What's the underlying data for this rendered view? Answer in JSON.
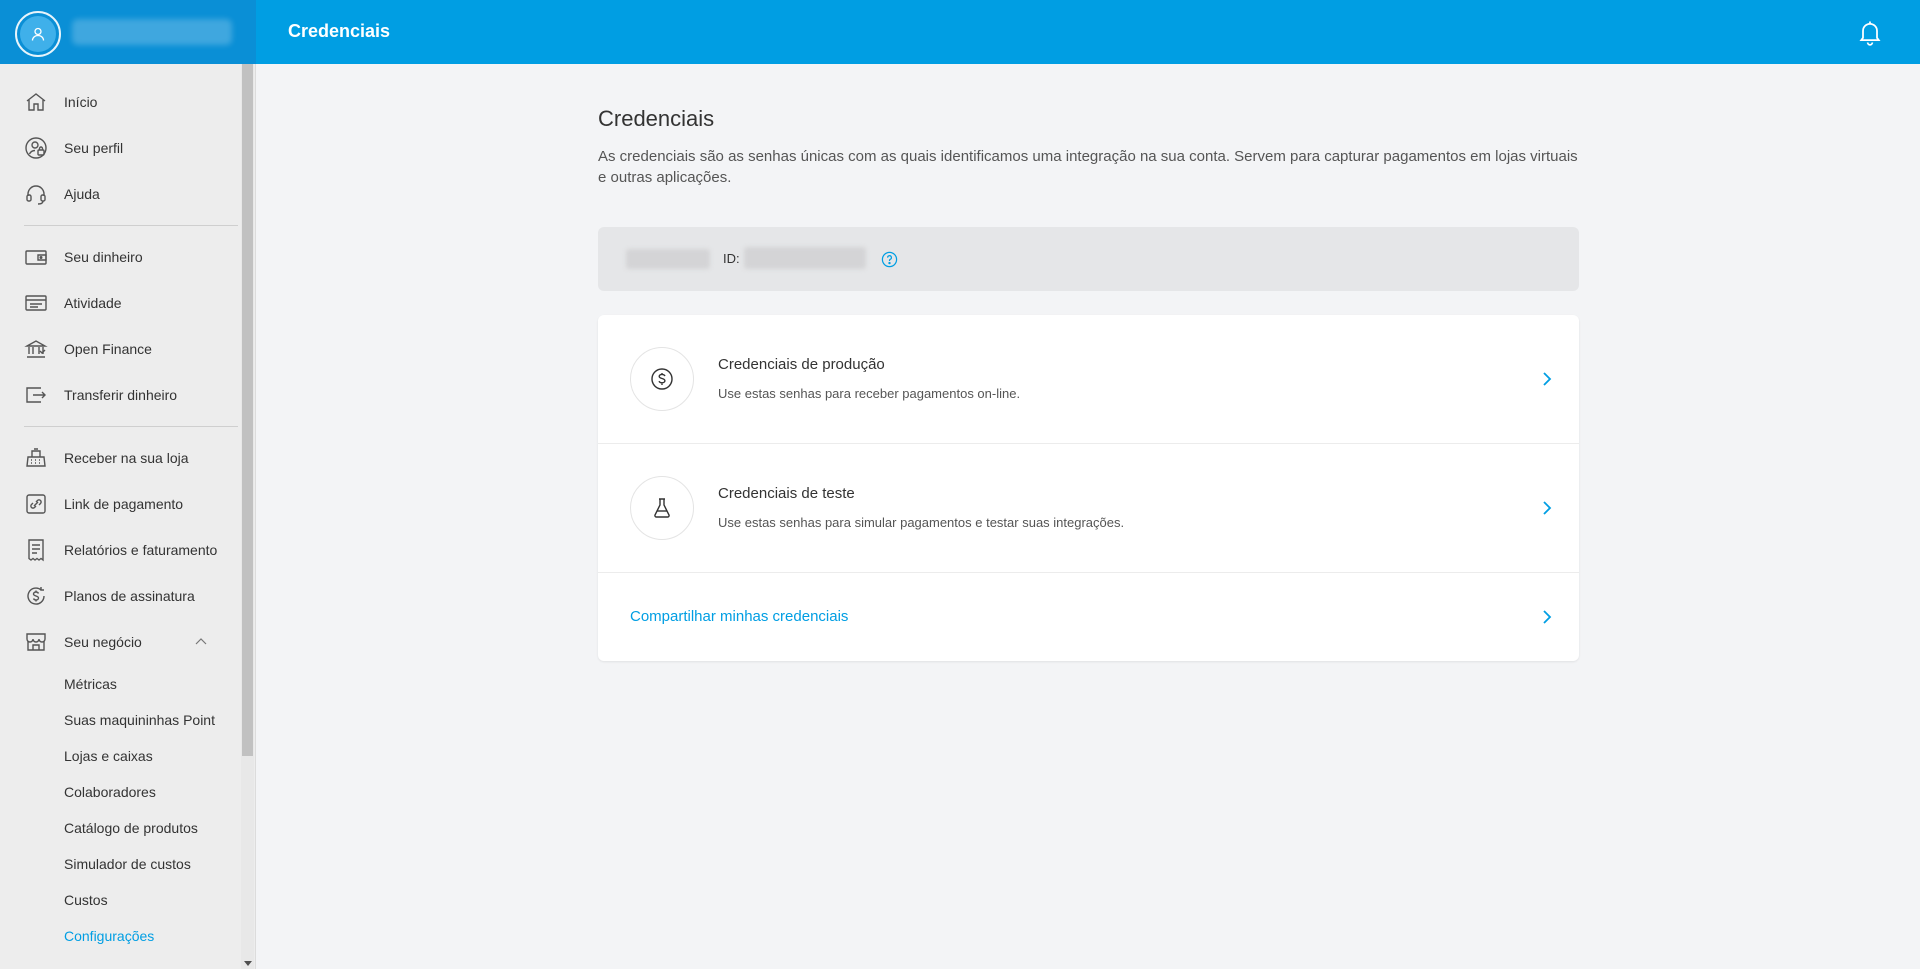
{
  "header": {
    "title": "Credenciais",
    "user_name": "",
    "icons": {
      "avatar": "user-icon",
      "notifications": "bell-icon"
    }
  },
  "sidebar": {
    "items": [
      {
        "label": "Início",
        "icon": "home-icon"
      },
      {
        "label": "Seu perfil",
        "icon": "profile-icon"
      },
      {
        "label": "Ajuda",
        "icon": "headset-icon"
      },
      {
        "label": "Seu dinheiro",
        "icon": "wallet-icon"
      },
      {
        "label": "Atividade",
        "icon": "activity-icon"
      },
      {
        "label": "Open Finance",
        "icon": "bank-icon"
      },
      {
        "label": "Transferir dinheiro",
        "icon": "transfer-icon"
      },
      {
        "label": "Receber na sua loja",
        "icon": "cash-register-icon"
      },
      {
        "label": "Link de pagamento",
        "icon": "link-icon"
      },
      {
        "label": "Relatórios e faturamento",
        "icon": "receipt-icon"
      },
      {
        "label": "Planos de assinatura",
        "icon": "subscription-icon"
      },
      {
        "label": "Seu negócio",
        "icon": "store-icon"
      }
    ],
    "sub_items": [
      {
        "label": "Métricas"
      },
      {
        "label": "Suas maquininhas Point"
      },
      {
        "label": "Lojas e caixas"
      },
      {
        "label": "Colaboradores"
      },
      {
        "label": "Catálogo de produtos"
      },
      {
        "label": "Simulador de custos"
      },
      {
        "label": "Custos"
      },
      {
        "label": "Configurações"
      }
    ]
  },
  "main": {
    "title": "Credenciais",
    "description": "As credenciais são as senhas únicas com as quais identificamos uma integração na sua conta. Servem para capturar pagamentos em lojas virtuais e outras aplicações.",
    "id_bar": {
      "id_label": "ID:"
    },
    "rows": [
      {
        "title": "Credenciais de produção",
        "text": "Use estas senhas para receber pagamentos on-line.",
        "icon": "dollar-icon"
      },
      {
        "title": "Credenciais de teste",
        "text": "Use estas senhas para simular pagamentos e testar suas integrações.",
        "icon": "flask-icon"
      }
    ],
    "share": {
      "label": "Compartilhar minhas credenciais"
    }
  },
  "colors": {
    "brand": "#009ee3",
    "brand_dark": "#0a8fd6",
    "background": "#f3f4f6"
  }
}
